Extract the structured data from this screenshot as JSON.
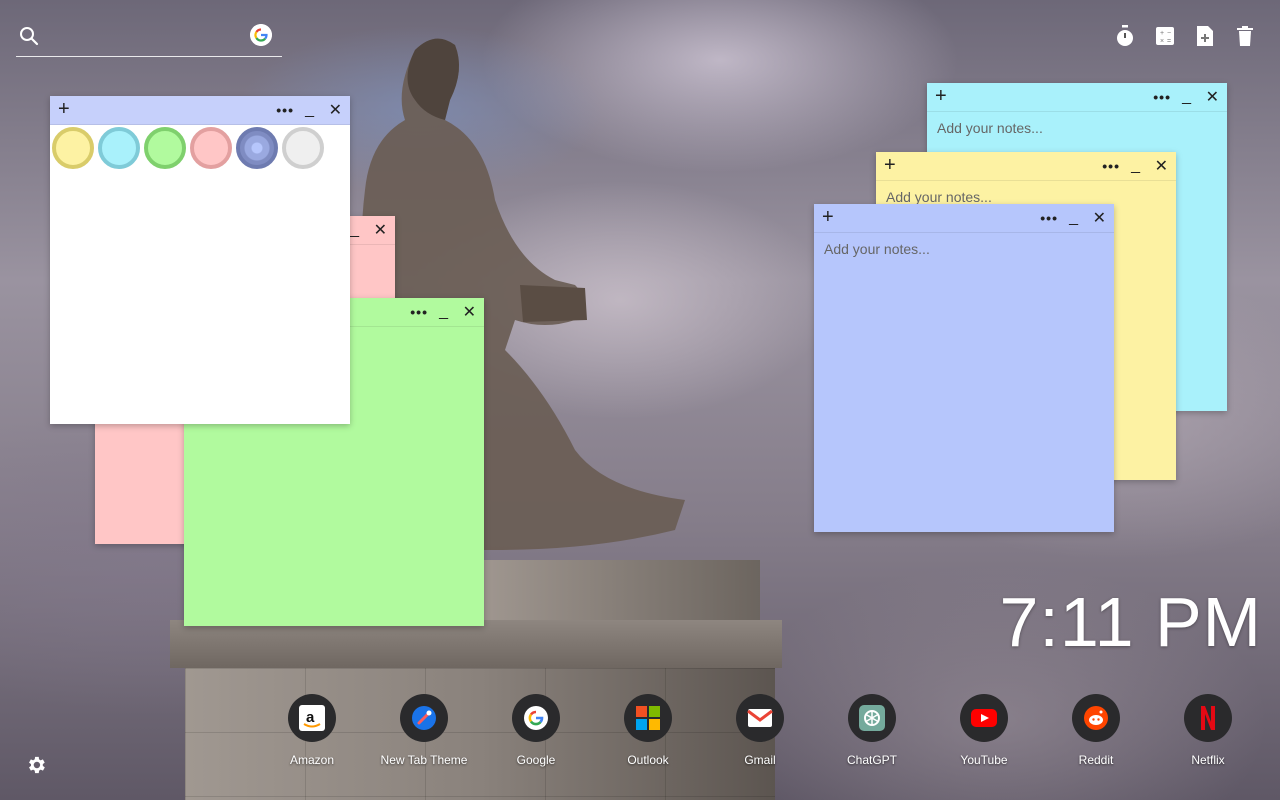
{
  "search": {
    "placeholder": ""
  },
  "toolbar": {
    "items": [
      "timer-icon",
      "calculator-icon",
      "add-note-icon",
      "trash-icon"
    ]
  },
  "notes": [
    {
      "id": "cyan",
      "color": "#a9f1fb",
      "placeholder": "Add your notes..."
    },
    {
      "id": "yellow",
      "color": "#fdf2a3",
      "placeholder": "Add your notes..."
    },
    {
      "id": "blue",
      "color": "#b6c6fc",
      "placeholder": "Add your notes..."
    },
    {
      "id": "pink",
      "color": "#ffc6c6",
      "placeholder": ""
    },
    {
      "id": "green",
      "color": "#b1fa9e",
      "placeholder": ""
    },
    {
      "id": "white",
      "color": "#ffffff",
      "placeholder": ""
    }
  ],
  "palette": [
    "#fdf2a3",
    "#a9f1fb",
    "#b1fa9e",
    "#ffc6c6",
    "#b6c6fc",
    "#efefef"
  ],
  "clock": {
    "time": "7:11 PM"
  },
  "dock": [
    {
      "label": "Amazon",
      "icon": "amazon-icon"
    },
    {
      "label": "New Tab Theme",
      "icon": "new-tab-theme-icon"
    },
    {
      "label": "Google",
      "icon": "google-icon"
    },
    {
      "label": "Outlook",
      "icon": "outlook-icon"
    },
    {
      "label": "Gmail",
      "icon": "gmail-icon"
    },
    {
      "label": "ChatGPT",
      "icon": "chatgpt-icon"
    },
    {
      "label": "YouTube",
      "icon": "youtube-icon"
    },
    {
      "label": "Reddit",
      "icon": "reddit-icon"
    },
    {
      "label": "Netflix",
      "icon": "netflix-icon"
    }
  ]
}
